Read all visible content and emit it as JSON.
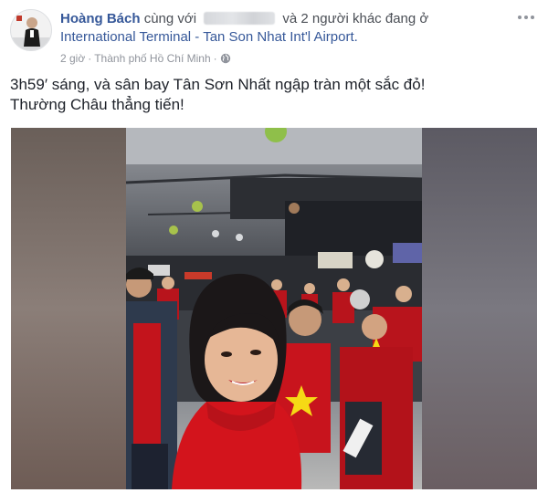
{
  "post": {
    "author": "Hoàng Bách",
    "with_text": "cùng với",
    "others_text": "và 2 người khác",
    "at_text": "đang ở",
    "location": "International Terminal - Tan Son Nhat Int'l Airport.",
    "time": "2 giờ",
    "separator": "·",
    "city": "Thành phố Hồ Chí Minh",
    "separator2": "·",
    "privacy_icon": "globe-icon",
    "message_line1": "3h59′ sáng, và sân bay Tân Sơn Nhất ngập tràn một sắc đỏ!",
    "message_line2": "Thường Châu thẳng tiến!"
  },
  "colors": {
    "link": "#365899",
    "muted": "#90949c",
    "text": "#1d2129",
    "jersey_red": "#d3141c",
    "star_yellow": "#f6d915"
  }
}
